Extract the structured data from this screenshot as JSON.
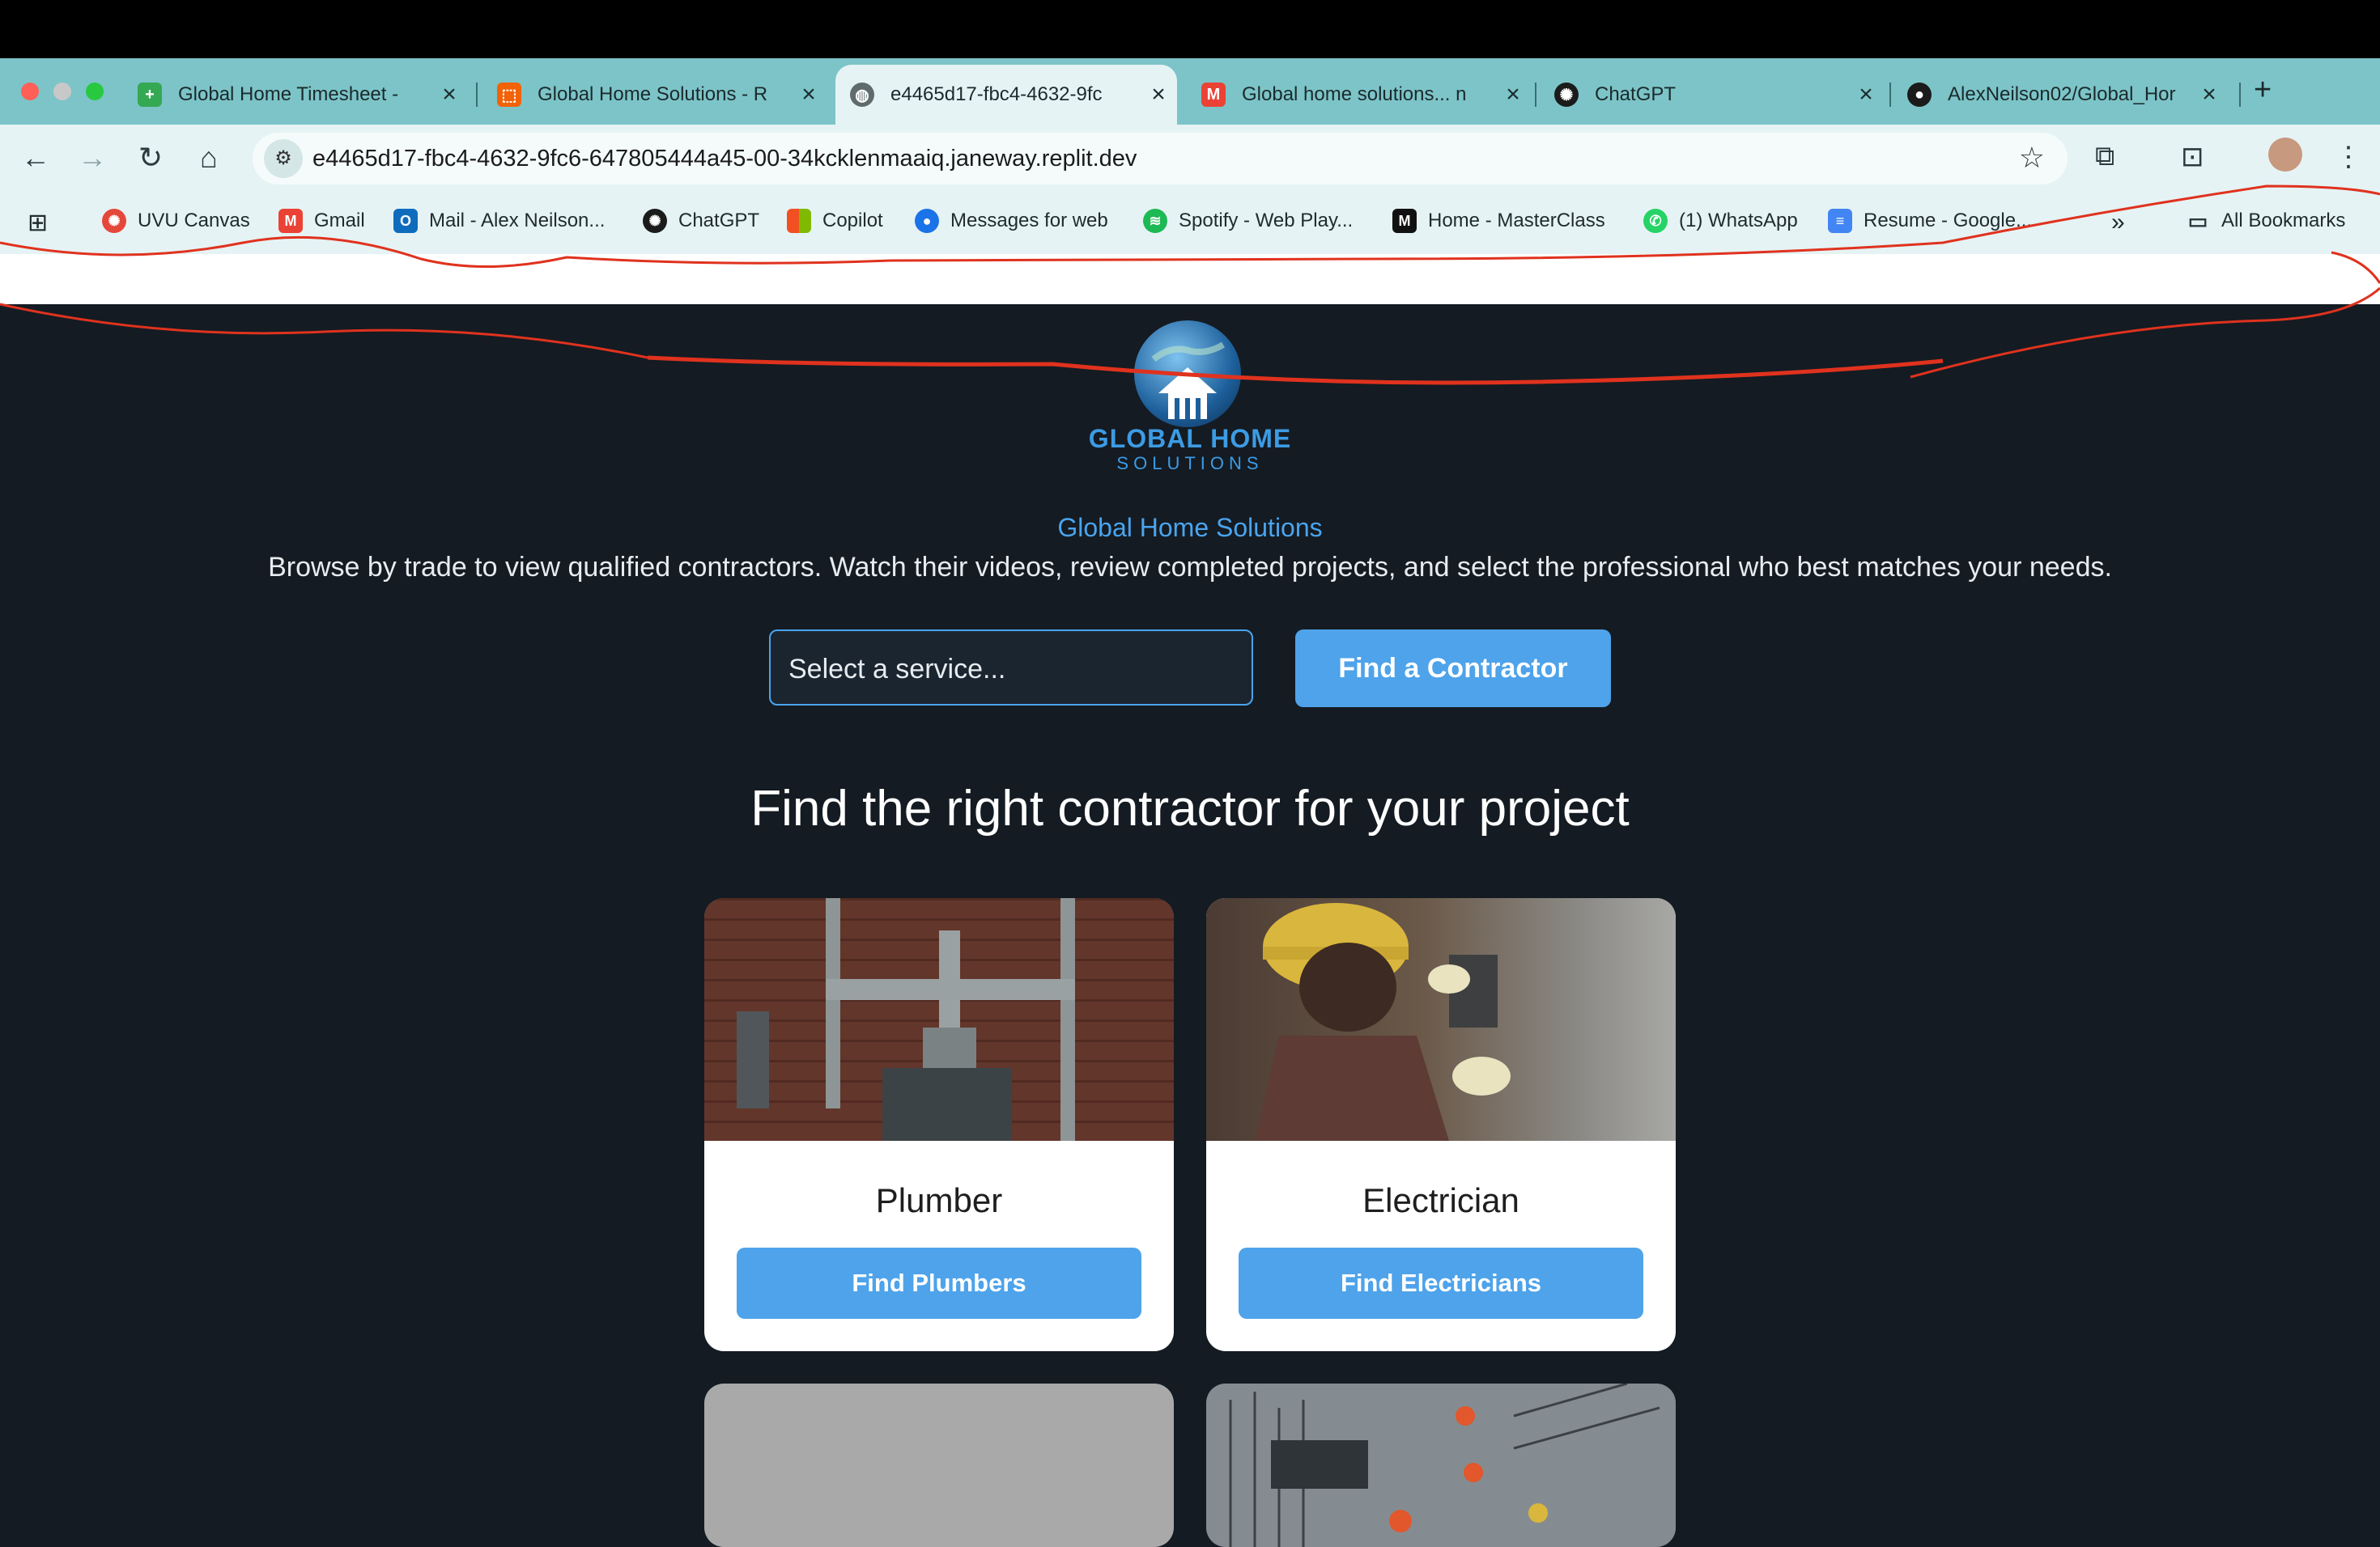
{
  "browser": {
    "tabs": [
      {
        "title": "Global Home Timesheet -",
        "icon": "sheets-icon",
        "color": "#34a853",
        "active": false
      },
      {
        "title": "Global Home Solutions - R",
        "icon": "replit-icon",
        "color": "#f26207",
        "active": false
      },
      {
        "title": "e4465d17-fbc4-4632-9fc",
        "icon": "globe-icon",
        "color": "#5f6b6d",
        "active": true
      },
      {
        "title": "Global home solutions... n",
        "icon": "gmail-icon",
        "color": "#ea4335",
        "active": false
      },
      {
        "title": "ChatGPT",
        "icon": "openai-icon",
        "color": "#1b1b1b",
        "active": false
      },
      {
        "title": "AlexNeilson02/Global_Hor",
        "icon": "github-icon",
        "color": "#1b1b1b",
        "active": false
      }
    ],
    "url": "e4465d17-fbc4-4632-9fc6-647805444a45-00-34kcklenmaaiq.janeway.replit.dev",
    "bookmarks": [
      {
        "label": "UVU Canvas",
        "icon": "canvas-icon",
        "color": "#e5483a"
      },
      {
        "label": "Gmail",
        "icon": "gmail-icon",
        "color": "#ea4335"
      },
      {
        "label": "Mail - Alex Neilson...",
        "icon": "outlook-icon",
        "color": "#0f6cbd"
      },
      {
        "label": "ChatGPT",
        "icon": "openai-icon",
        "color": "#1b1b1b"
      },
      {
        "label": "Copilot",
        "icon": "microsoft-icon",
        "color": "#f25022"
      },
      {
        "label": "Messages for web",
        "icon": "messages-icon",
        "color": "#1a73e8"
      },
      {
        "label": "Spotify - Web Play...",
        "icon": "spotify-icon",
        "color": "#1db954"
      },
      {
        "label": "Home - MasterClass",
        "icon": "masterclass-icon",
        "color": "#111111"
      },
      {
        "label": "(1) WhatsApp",
        "icon": "whatsapp-icon",
        "color": "#25d366"
      },
      {
        "label": "Resume - Google...",
        "icon": "docs-icon",
        "color": "#4285f4"
      }
    ],
    "all_bookmarks": "All Bookmarks",
    "more_bookmarks": "»"
  },
  "site": {
    "brand": "GLOBAL HOME",
    "brand_sub": "SOLUTIONS",
    "tagline": "Global Home Solutions",
    "description": "Browse by trade to view qualified contractors. Watch their videos, review completed projects, and select the professional who best matches your needs.",
    "select_placeholder": "Select a service...",
    "find_button": "Find a Contractor",
    "heading": "Find the right contractor for your project",
    "cards": [
      {
        "name": "Plumber",
        "button": "Find Plumbers"
      },
      {
        "name": "Electrician",
        "button": "Find Electricians"
      }
    ]
  },
  "colors": {
    "accent": "#4ea3ea",
    "page_bg": "#141b22",
    "browser_chrome": "#7cc4c8",
    "annotation": "#e0321e"
  }
}
